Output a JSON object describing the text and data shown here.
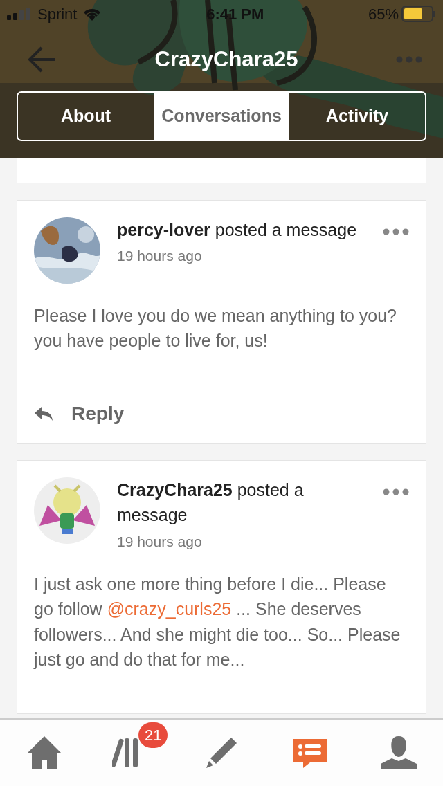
{
  "status_bar": {
    "carrier": "Sprint",
    "time": "6:41 PM",
    "battery": "65%"
  },
  "header": {
    "title": "CrazyChara25"
  },
  "tabs": [
    {
      "label": "About",
      "selected": false
    },
    {
      "label": "Conversations",
      "selected": true
    },
    {
      "label": "Activity",
      "selected": false
    }
  ],
  "posts": [
    {
      "headline": "**percy-lover** posted a message",
      "time": "19 hours ago",
      "message": [
        {
          "kind": "text",
          "text": "Please I love you do we mean anything to you? you have people to live for, us!"
        }
      ],
      "reply": "Reply"
    },
    {
      "headline": "**CrazyChara25** posted a message",
      "time": "19 hours ago",
      "message": [
        {
          "kind": "text",
          "text": "I just ask one more thing before I die... Please go follow "
        },
        {
          "kind": "mention",
          "text": "@crazy_curls25"
        },
        {
          "kind": "text",
          "text": " ... She deserves followers... And she might die too... So... Please just go and do that for me..."
        }
      ]
    }
  ],
  "bottom_nav": [
    {
      "selected": false
    },
    {
      "selected": false,
      "badge": "21"
    },
    {
      "selected": false
    },
    {
      "selected": true
    },
    {
      "selected": false
    }
  ]
}
